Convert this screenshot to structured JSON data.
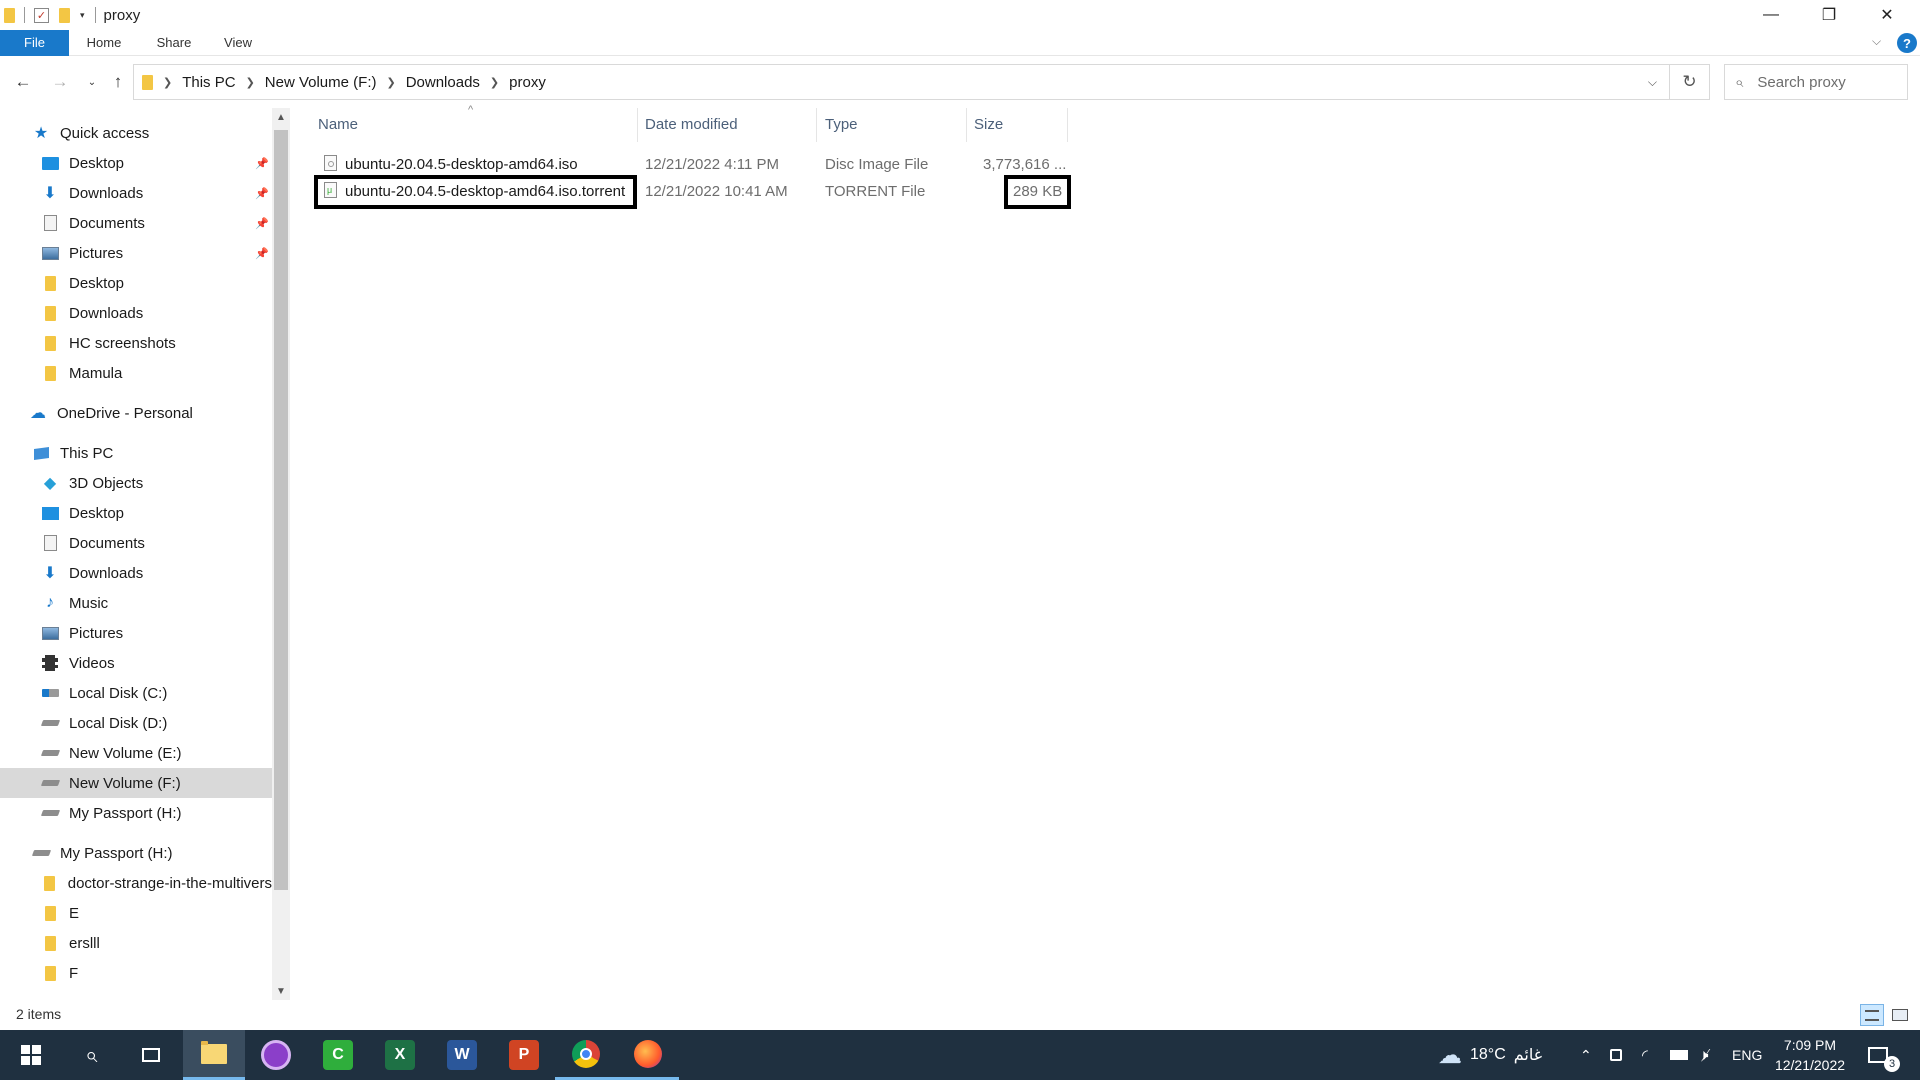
{
  "window": {
    "title": "proxy",
    "minimize": "—",
    "restore": "❐",
    "close": "✕",
    "help": "?"
  },
  "ribbon": {
    "tabs": [
      "File",
      "Home",
      "Share",
      "View"
    ]
  },
  "address": {
    "crumbs": [
      "This PC",
      "New Volume (F:)",
      "Downloads",
      "proxy"
    ]
  },
  "search": {
    "placeholder": "Search proxy"
  },
  "nav": {
    "quick_access": "Quick access",
    "quick_items": [
      "Desktop",
      "Downloads",
      "Documents",
      "Pictures",
      "Desktop",
      "Downloads",
      "HC screenshots",
      "Mamula"
    ],
    "onedrive": "OneDrive - Personal",
    "this_pc": "This PC",
    "pc_items": [
      "3D Objects",
      "Desktop",
      "Documents",
      "Downloads",
      "Music",
      "Pictures",
      "Videos",
      "Local Disk (C:)",
      "Local Disk (D:)",
      "New Volume (E:)",
      "New Volume (F:)",
      "My Passport (H:)"
    ],
    "passport": "My Passport (H:)",
    "passport_items": [
      "doctor-strange-in-the-multivers",
      "E",
      "erslll",
      "F"
    ]
  },
  "columns": {
    "name": "Name",
    "date": "Date modified",
    "type": "Type",
    "size": "Size"
  },
  "files": [
    {
      "name": "ubuntu-20.04.5-desktop-amd64.iso",
      "date": "12/21/2022 4:11 PM",
      "type": "Disc Image File",
      "size": "3,773,616 ..."
    },
    {
      "name": "ubuntu-20.04.5-desktop-amd64.iso.torrent",
      "date": "12/21/2022 10:41 AM",
      "type": "TORRENT File",
      "size": "289 KB"
    }
  ],
  "status": {
    "count": "2 items"
  },
  "taskbar": {
    "weather_temp": "18°C",
    "weather_text": "غائم",
    "language": "ENG",
    "time": "7:09 PM",
    "date": "12/21/2022",
    "notifications": "3"
  }
}
